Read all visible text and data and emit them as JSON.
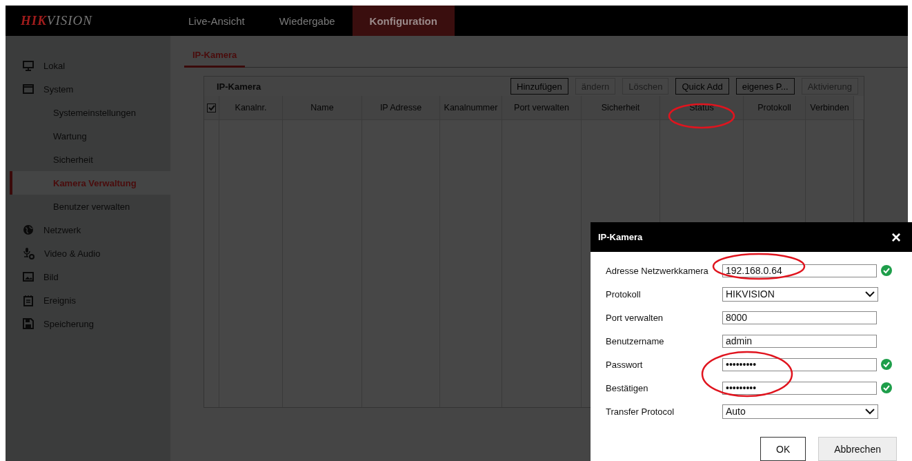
{
  "header": {
    "logo": {
      "lead": "HIK",
      "rest": "VISION"
    },
    "tabs": [
      {
        "label": "Live-Ansicht",
        "selected": false
      },
      {
        "label": "Wiedergabe",
        "selected": false
      },
      {
        "label": "Konfiguration",
        "selected": true
      }
    ]
  },
  "sidebar": {
    "items": [
      {
        "label": "Lokal"
      },
      {
        "label": "System",
        "children": [
          {
            "label": "Systemeinstellungen",
            "selected": false
          },
          {
            "label": "Wartung",
            "selected": false
          },
          {
            "label": "Sicherheit",
            "selected": false
          },
          {
            "label": "Kamera Verwaltung",
            "selected": true
          },
          {
            "label": "Benutzer verwalten",
            "selected": false
          }
        ]
      },
      {
        "label": "Netzwerk"
      },
      {
        "label": "Video & Audio"
      },
      {
        "label": "Bild"
      },
      {
        "label": "Ereignis"
      },
      {
        "label": "Speicherung"
      }
    ]
  },
  "page_tabs": [
    {
      "label": "IP-Kamera",
      "selected": true
    }
  ],
  "table": {
    "title": "IP-Kamera",
    "buttons": [
      {
        "label": "Hinzufügen",
        "disabled": false
      },
      {
        "label": "ändern",
        "disabled": true
      },
      {
        "label": "Löschen",
        "disabled": true
      },
      {
        "label": "Quick Add",
        "disabled": false
      },
      {
        "label": "eigenes P...",
        "disabled": false
      },
      {
        "label": "Aktivierung",
        "disabled": true
      }
    ],
    "select_all": {
      "checked": true
    },
    "columns": [
      "Kanalnr.",
      "Name",
      "IP Adresse",
      "Kanalnummer",
      "Port verwalten",
      "Sicherheit",
      "Status",
      "Protokoll",
      "Verbinden"
    ]
  },
  "dialog": {
    "title": "IP-Kamera",
    "close": "×",
    "fields": [
      {
        "label": "Adresse Netzwerkkamera",
        "kind": "text",
        "value": "192.168.0.64",
        "valid": true
      },
      {
        "label": "Protokoll",
        "kind": "select",
        "value": "HIKVISION",
        "valid": false
      },
      {
        "label": "Port verwalten",
        "kind": "text",
        "value": "8000",
        "valid": false
      },
      {
        "label": "Benutzername",
        "kind": "text",
        "value": "admin",
        "valid": false
      },
      {
        "label": "Passwort",
        "kind": "text",
        "value": "•••••••••",
        "valid": true
      },
      {
        "label": "Bestätigen",
        "kind": "text",
        "value": "•••••••••",
        "valid": true
      },
      {
        "label": "Transfer Protocol",
        "kind": "select",
        "value": "Auto",
        "valid": false
      }
    ],
    "buttons": [
      "OK",
      "Abbrechen"
    ]
  }
}
